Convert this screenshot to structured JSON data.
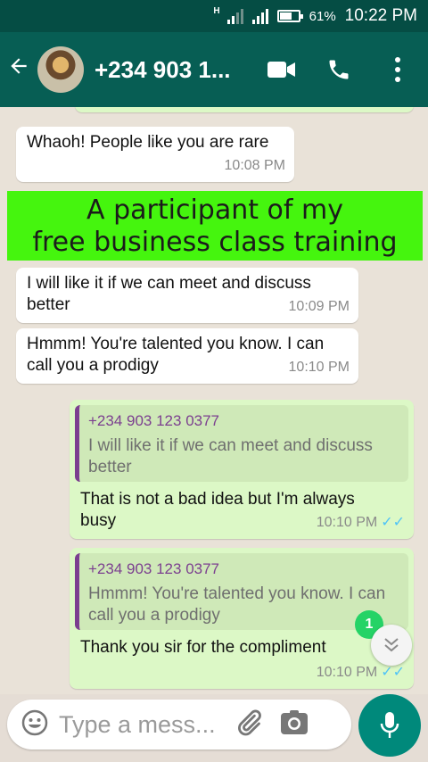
{
  "status_bar": {
    "network_type": "H",
    "battery": "61%",
    "battery_level": 0.61,
    "time": "10:22 PM"
  },
  "header": {
    "contact_name": "+234 903 1...",
    "icons": [
      "back-arrow-icon",
      "video-call-icon",
      "phone-icon",
      "more-options-icon"
    ]
  },
  "messages": [
    {
      "direction": "in",
      "text": "Whaoh! People like you are rare",
      "time": "10:08 PM"
    },
    {
      "direction": "in",
      "text": "I will like it if we can meet and discuss better",
      "time": "10:09 PM"
    },
    {
      "direction": "in",
      "text": "Hmmm! You're talented you know. I can call you a prodigy",
      "time": "10:10 PM"
    },
    {
      "direction": "out",
      "quote_name": "+234 903 123 0377",
      "quote_text": "I will like it if we can meet and discuss better",
      "text": "That is not a bad idea but I'm always busy",
      "time": "10:10 PM"
    },
    {
      "direction": "out",
      "quote_name": "+234 903 123 0377",
      "quote_text": "Hmmm! You're talented you know. I can call you a prodigy",
      "text": "Thank you sir for the compliment",
      "time": "10:10 PM"
    }
  ],
  "banner": {
    "line1": "A participant of my",
    "line2": "free business class training"
  },
  "unread_count": "1",
  "input": {
    "placeholder": "Type a mess..."
  },
  "colors": {
    "header": "#075e54",
    "status_bar": "#054d44",
    "outgoing_bubble": "#dcf8c6",
    "banner": "#45f50e",
    "mic_button": "#00897b",
    "read_ticks": "#4fc3f7"
  }
}
